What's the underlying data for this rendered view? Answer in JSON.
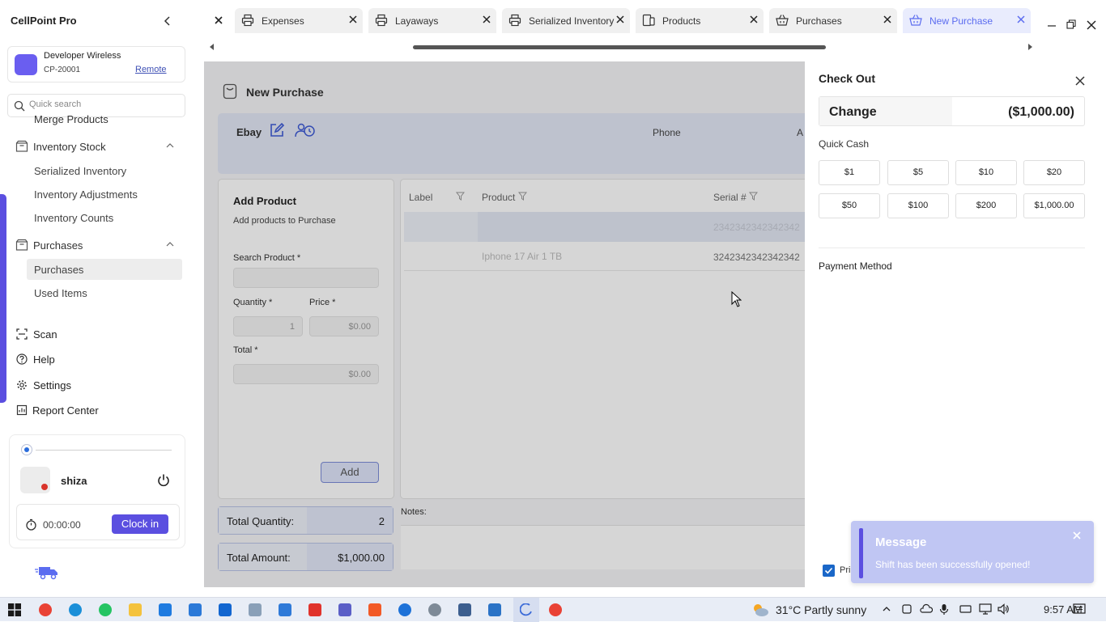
{
  "app": {
    "title": "CellPoint Pro"
  },
  "store": {
    "name": "Developer Wireless",
    "id": "CP-20001",
    "mode": "Remote",
    "logo_color": "#6a5ef0"
  },
  "search": {
    "placeholder": "Quick search"
  },
  "nav": {
    "merge_products": "Merge Products",
    "inventory_stock": "Inventory Stock",
    "serialized_inventory": "Serialized Inventory",
    "inventory_adjustments": "Inventory Adjustments",
    "inventory_counts": "Inventory Counts",
    "purchases_group": "Purchases",
    "purchases": "Purchases",
    "used_items": "Used Items",
    "scan": "Scan",
    "help": "Help",
    "settings": "Settings",
    "report_center": "Report Center"
  },
  "user": {
    "name": "shiza",
    "timer": "00:00:00",
    "clock_in": "Clock in"
  },
  "tabs": [
    {
      "label": "Expenses",
      "icon": "printer-icon"
    },
    {
      "label": "Layaways",
      "icon": "printer-icon"
    },
    {
      "label": "Serialized Inventory",
      "icon": "printer-icon"
    },
    {
      "label": "Products",
      "icon": "devices-icon"
    },
    {
      "label": "Purchases",
      "icon": "basket-icon"
    },
    {
      "label": "New Purchase",
      "icon": "basket-icon",
      "active": true
    }
  ],
  "purchase": {
    "title": "New Purchase",
    "supplier": "Ebay",
    "phone_label": "Phone",
    "a_label": "A",
    "add_product": {
      "title": "Add Product",
      "subtitle": "Add products to Purchase",
      "search_label": "Search Product *",
      "quantity_label": "Quantity *",
      "quantity_value": "1",
      "price_label": "Price *",
      "price_value": "$0.00",
      "total_label": "Total *",
      "total_value": "$0.00",
      "add_button": "Add"
    },
    "table": {
      "columns": [
        "Label",
        "Product",
        "Serial #"
      ],
      "rows": [
        {
          "label": "",
          "product": "",
          "serial": "2342342342342342"
        },
        {
          "label": "",
          "product": "Iphone 17 Air 1 TB",
          "serial": "3242342342342342"
        }
      ]
    },
    "total_quantity_label": "Total Quantity:",
    "total_quantity": "2",
    "total_amount_label": "Total Amount:",
    "total_amount": "$1,000.00",
    "notes_label": "Notes:"
  },
  "checkout": {
    "title": "Check Out",
    "change_label": "Change",
    "change_value": "($1,000.00)",
    "quick_cash_label": "Quick Cash",
    "quick_cash": [
      "$1",
      "$5",
      "$10",
      "$20",
      "$50",
      "$100",
      "$200",
      "$1,000.00"
    ],
    "payment_method_label": "Payment Method",
    "print_label": "Pri"
  },
  "toast": {
    "title": "Message",
    "message": "Shift has been successfully opened!"
  },
  "taskbar": {
    "weather": "31°C Partly sunny",
    "time": "9:57 AM"
  },
  "colors": {
    "accent": "#5b4fe0",
    "active_tab_text": "#5b6cf0",
    "toast_bg": "#c0c6f3"
  }
}
